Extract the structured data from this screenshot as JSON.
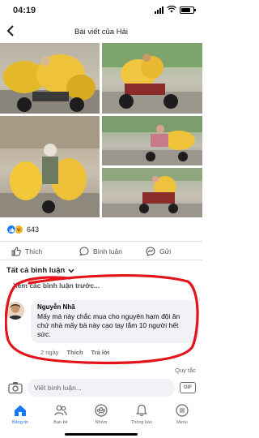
{
  "status_bar": {
    "time": "04:19"
  },
  "header": {
    "title": "Bài viết của Hải",
    "back_icon": "chevron-left-icon"
  },
  "photos": [
    "photo-1",
    "photo-2",
    "photo-3",
    "photo-4",
    "photo-5"
  ],
  "reactions": {
    "count": "643",
    "types": [
      "like",
      "haha"
    ],
    "colors": {
      "like": "#1877f2",
      "haha": "#f7b125"
    }
  },
  "actions": {
    "like_label": "Thích",
    "comment_label": "Bình luận",
    "share_label": "Gửi"
  },
  "comments": {
    "filter_label": "Tất cả bình luận",
    "view_previous": "Xem các bình luận trước...",
    "item": {
      "author": "Nguyễn Nhã",
      "text": "Mấy má này chắc mua cho nguyên hạm đội ăn chứ nhà mấy bà này cao tay lắm 10 người hết sức.",
      "time": "2 ngày",
      "like_label": "Thích",
      "reply_label": "Trả lời"
    },
    "rules_label": "Quy tắc"
  },
  "composer": {
    "placeholder": "Viết bình luận...",
    "gif_label": "GIF"
  },
  "tab_bar": {
    "items": [
      {
        "label": "Bảng tin",
        "icon": "home-icon",
        "active": true
      },
      {
        "label": "Bạn bè",
        "icon": "friends-icon",
        "active": false
      },
      {
        "label": "Nhóm",
        "icon": "groups-icon",
        "active": false
      },
      {
        "label": "Thông báo",
        "icon": "bell-icon",
        "active": false
      },
      {
        "label": "Menu",
        "icon": "menu-icon",
        "active": false
      }
    ]
  },
  "colors": {
    "accent": "#1877f2",
    "highlight": "#e4141b"
  }
}
